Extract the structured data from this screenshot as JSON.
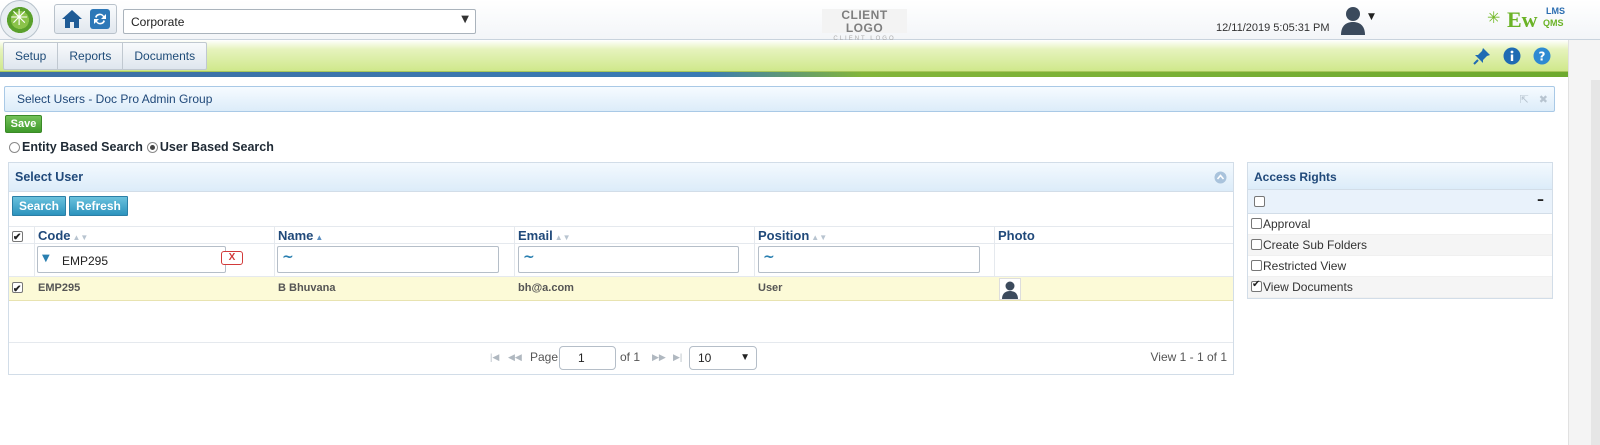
{
  "header": {
    "entity_value": "Corporate",
    "client_logo_main": "CLIENT LOGO",
    "client_logo_sub": "CLIENT LOGO",
    "datetime": "12/11/2019 5:05:31 PM",
    "brand_main": "Ew",
    "brand_lms": "LMS",
    "brand_qms": "QMS"
  },
  "menu": {
    "tabs": [
      "Setup",
      "Reports",
      "Documents"
    ]
  },
  "dialog": {
    "title": "Select Users - Doc Pro Admin Group",
    "save_label": "Save"
  },
  "search_mode": {
    "options": [
      "Entity Based Search",
      "User Based Search"
    ],
    "selected": "User Based Search"
  },
  "select_user": {
    "title": "Select User",
    "search_label": "Search",
    "refresh_label": "Refresh",
    "columns": [
      "Code",
      "Name",
      "Email",
      "Position",
      "Photo"
    ],
    "filters": {
      "code": "EMP295",
      "name": "~",
      "email": "~",
      "position": "~",
      "clear_label": "X"
    },
    "rows": [
      {
        "checked": true,
        "code": "EMP295",
        "name": "B Bhuvana",
        "email": "bh@a.com",
        "position": "User"
      }
    ],
    "pager": {
      "page_label": "Page",
      "page_value": "1",
      "of_label": "of 1",
      "page_size": "10",
      "view_text": "View 1 - 1 of 1"
    }
  },
  "access_rights": {
    "title": "Access Rights",
    "items": [
      {
        "label": "Approval",
        "checked": false
      },
      {
        "label": "Create Sub Folders",
        "checked": false
      },
      {
        "label": "Restricted View",
        "checked": false
      },
      {
        "label": "View Documents",
        "checked": true
      }
    ]
  },
  "colors": {
    "accent_green": "#6bb327",
    "accent_blue": "#20497a",
    "row_highlight": "#fcfad7"
  }
}
